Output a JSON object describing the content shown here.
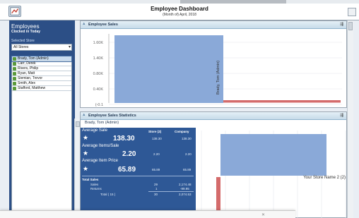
{
  "header": {
    "title": "Employee Dashboard",
    "subtitle": "(Month of) April, 2018"
  },
  "sidebar": {
    "title": "Employees",
    "subtitle": "Clocked in Today",
    "store_label": "Selected Store",
    "store_value": "All Stores",
    "employees": [
      {
        "name": "Brady, Tom (Admin)",
        "selected": true
      },
      {
        "name": "Carr, Derek",
        "selected": false
      },
      {
        "name": "Rivers, Philip",
        "selected": false
      },
      {
        "name": "Ryan, Matt",
        "selected": false
      },
      {
        "name": "Siemian, Trevor",
        "selected": false
      },
      {
        "name": "Smith, Alex",
        "selected": false
      },
      {
        "name": "Stafford, Matthew",
        "selected": false
      }
    ]
  },
  "sales_panel": {
    "title": "Employee Sales",
    "chart_data": {
      "type": "bar",
      "categories": [
        "Brady, Tom (Admin)"
      ],
      "series": [
        {
          "values": [
            2.0
          ],
          "color": "#8aa9d8"
        },
        {
          "values": [
            0.03
          ],
          "color": "#d46b6b"
        }
      ],
      "y_ticks": [
        "1.60K",
        "1.40K",
        "0.80K",
        "0.40K",
        "(-0.1"
      ],
      "data_label": "Brady, Tom (Admin)",
      "grid": true
    }
  },
  "stats_panel": {
    "title": "Employee Sales Statistics",
    "subtitle": "Brady, Tom (Admin)",
    "col_store": "Store (2)",
    "col_company": "Company",
    "avg_sale_label": "Average Sale",
    "avg_sale_value": "138.30",
    "avg_sale_store": "138.30",
    "avg_sale_company": "138.30",
    "avg_items_label": "Average Items/Sale",
    "avg_items_value": "2.20",
    "avg_items_store": "2.20",
    "avg_items_company": "2.20",
    "avg_price_label": "Average Item Price",
    "avg_price_value": "65.89",
    "avg_price_store": "65.89",
    "avg_price_company": "65.89",
    "total_sales_label": "Total Sales",
    "sales_label": "Sales",
    "sales_store": "29",
    "sales_company": "2,174.48",
    "returns_label": "Returns",
    "returns_store": "1",
    "returns_company": "-99.95",
    "total_label": "Total ( 15 )",
    "total_store": "30",
    "total_company": "2,074.53",
    "chart_data": {
      "type": "bar",
      "series": [
        {
          "values": [
            1.0
          ],
          "color": "#8aa9d8"
        },
        {
          "values": [
            1.0
          ],
          "color": "#d46b6b"
        }
      ],
      "data_label": "Your Store Name 2 (2)"
    }
  },
  "colors": {
    "sidebar_bg": "#2c4f86",
    "stats_bg": "#2e5896",
    "bar_blue": "#8aa9d8",
    "bar_red": "#d46b6b",
    "header_grad": "#c6dbe9"
  }
}
